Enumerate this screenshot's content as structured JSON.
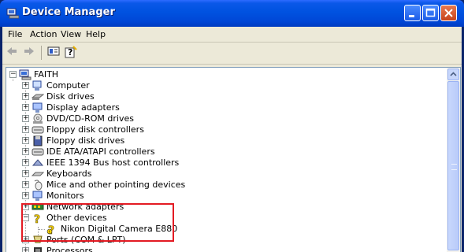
{
  "window": {
    "title": "Device Manager"
  },
  "menu": [
    "File",
    "Action",
    "View",
    "Help"
  ],
  "toolbar": {
    "back_icon": "back-arrow",
    "forward_icon": "forward-arrow",
    "properties_icon": "properties",
    "help_icon": "help"
  },
  "tree": {
    "root": "FAITH",
    "items": [
      {
        "label": "Computer",
        "icon": "computer"
      },
      {
        "label": "Disk drives",
        "icon": "disk-drive"
      },
      {
        "label": "Display adapters",
        "icon": "display-adapter"
      },
      {
        "label": "DVD/CD-ROM drives",
        "icon": "cdrom"
      },
      {
        "label": "Floppy disk controllers",
        "icon": "floppy-controller"
      },
      {
        "label": "Floppy disk drives",
        "icon": "floppy-drive"
      },
      {
        "label": "IDE ATA/ATAPI controllers",
        "icon": "ide-controller"
      },
      {
        "label": "IEEE 1394 Bus host controllers",
        "icon": "ieee1394"
      },
      {
        "label": "Keyboards",
        "icon": "keyboard"
      },
      {
        "label": "Mice and other pointing devices",
        "icon": "mouse"
      },
      {
        "label": "Monitors",
        "icon": "monitor"
      },
      {
        "label": "Network adapters",
        "icon": "network-adapter"
      },
      {
        "label": "Other devices",
        "icon": "unknown-device",
        "expanded": true
      },
      {
        "label": "Nikon Digital Camera E880",
        "icon": "unknown-device",
        "child": true
      },
      {
        "label": "Ports (COM & LPT)",
        "icon": "port"
      },
      {
        "label": "Processors",
        "icon": "processor"
      }
    ]
  },
  "colors": {
    "highlight": "#e31b23",
    "titlebar": "#0052e0"
  }
}
